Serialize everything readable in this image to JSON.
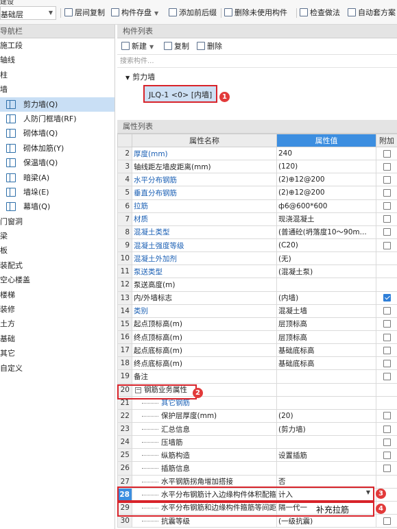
{
  "toolbar": {
    "menu_fragment": "建设",
    "floor_value": "基础层",
    "buttons": [
      {
        "label": "层间复制"
      },
      {
        "label": "构件存盘",
        "dropdown": true
      },
      {
        "label": "添加前后缀"
      },
      {
        "label": "删除未使用构件"
      },
      {
        "label": "检查做法"
      },
      {
        "label": "自动套方案"
      }
    ]
  },
  "nav": {
    "header": "导航栏",
    "items": [
      {
        "label": "施工段",
        "level": 0
      },
      {
        "label": "轴线",
        "level": 0
      },
      {
        "label": "柱",
        "level": 0
      },
      {
        "label": "墙",
        "level": 0
      },
      {
        "label": "剪力墙(Q)",
        "level": 1,
        "selected": true,
        "icon": "shear-wall-icon"
      },
      {
        "label": "人防门框墙(RF)",
        "level": 1,
        "icon": "civil-defense-door-frame-wall-icon"
      },
      {
        "label": "砌体墙(Q)",
        "level": 1,
        "icon": "masonry-wall-icon"
      },
      {
        "label": "砌体加筋(Y)",
        "level": 1,
        "icon": "masonry-reinforcement-icon"
      },
      {
        "label": "保温墙(Q)",
        "level": 1,
        "icon": "insulation-wall-icon"
      },
      {
        "label": "暗梁(A)",
        "level": 1,
        "icon": "hidden-beam-icon"
      },
      {
        "label": "墙垛(E)",
        "level": 1,
        "icon": "wall-pier-icon"
      },
      {
        "label": "幕墙(Q)",
        "level": 1,
        "icon": "curtain-wall-icon"
      },
      {
        "label": "门窗洞",
        "level": 0
      },
      {
        "label": "梁",
        "level": 0
      },
      {
        "label": "板",
        "level": 0
      },
      {
        "label": "装配式",
        "level": 0
      },
      {
        "label": "空心楼盖",
        "level": 0
      },
      {
        "label": "楼梯",
        "level": 0
      },
      {
        "label": "装修",
        "level": 0
      },
      {
        "label": "土方",
        "level": 0
      },
      {
        "label": "基础",
        "level": 0
      },
      {
        "label": "其它",
        "level": 0
      },
      {
        "label": "自定义",
        "level": 0
      }
    ]
  },
  "components": {
    "header": "构件列表",
    "new_label": "新建",
    "copy_label": "复制",
    "delete_label": "删除",
    "search_placeholder": "搜索构件...",
    "category": "剪力墙",
    "selected_item": "JLQ-1 <0> [内墙]",
    "badge": "1"
  },
  "properties": {
    "header": "属性列表",
    "columns": {
      "name": "属性名称",
      "value": "属性值",
      "extra": "附加"
    },
    "rows": [
      {
        "num": "2",
        "name": "厚度(mm)",
        "value": "240",
        "blue": true,
        "cb": "off"
      },
      {
        "num": "3",
        "name": "轴线距左墙皮距离(mm)",
        "value": "(120)",
        "blue": false,
        "cb": "off"
      },
      {
        "num": "4",
        "name": "水平分布钢筋",
        "value": "(2)⊕12@200",
        "blue": true,
        "cb": "off"
      },
      {
        "num": "5",
        "name": "垂直分布钢筋",
        "value": "(2)⊕12@200",
        "blue": true,
        "cb": "off"
      },
      {
        "num": "6",
        "name": "拉筋",
        "value": "ф6@600*600",
        "blue": true,
        "cb": "off"
      },
      {
        "num": "7",
        "name": "材质",
        "value": "现浇混凝土",
        "blue": true,
        "cb": "off"
      },
      {
        "num": "8",
        "name": "混凝土类型",
        "value": "(普通砼(坍落度10～90m...",
        "blue": true,
        "cb": "off"
      },
      {
        "num": "9",
        "name": "混凝土强度等级",
        "value": "(C20)",
        "blue": true,
        "cb": "off"
      },
      {
        "num": "10",
        "name": "混凝土外加剂",
        "value": "(无)",
        "blue": true,
        "cb": "none"
      },
      {
        "num": "11",
        "name": "泵送类型",
        "value": "(混凝土泵)",
        "blue": true,
        "cb": "none"
      },
      {
        "num": "12",
        "name": "泵送高度(m)",
        "value": "",
        "blue": false,
        "cb": "none"
      },
      {
        "num": "13",
        "name": "内/外墙标志",
        "value": "(内墙)",
        "blue": false,
        "cb": "on"
      },
      {
        "num": "14",
        "name": "类别",
        "value": "混凝土墙",
        "blue": true,
        "cb": "off"
      },
      {
        "num": "15",
        "name": "起点顶标高(m)",
        "value": "层顶标高",
        "blue": false,
        "cb": "off"
      },
      {
        "num": "16",
        "name": "终点顶标高(m)",
        "value": "层顶标高",
        "blue": false,
        "cb": "off"
      },
      {
        "num": "17",
        "name": "起点底标高(m)",
        "value": "基础底标高",
        "blue": false,
        "cb": "off"
      },
      {
        "num": "18",
        "name": "终点底标高(m)",
        "value": "基础底标高",
        "blue": false,
        "cb": "off"
      },
      {
        "num": "19",
        "name": "备注",
        "value": "",
        "blue": false,
        "cb": "off"
      },
      {
        "num": "20",
        "name": "钢筋业务属性",
        "value": "",
        "blue": false,
        "cb": "none",
        "group": true
      },
      {
        "num": "21",
        "name": "其它钢筋",
        "value": "",
        "blue": true,
        "cb": "none",
        "child": true
      },
      {
        "num": "22",
        "name": "保护层厚度(mm)",
        "value": "(20)",
        "blue": false,
        "cb": "off",
        "child": true
      },
      {
        "num": "23",
        "name": "汇总信息",
        "value": "(剪力墙)",
        "blue": false,
        "cb": "off",
        "child": true
      },
      {
        "num": "24",
        "name": "压墙筋",
        "value": "",
        "blue": false,
        "cb": "off",
        "child": true
      },
      {
        "num": "25",
        "name": "纵筋构造",
        "value": "设置插筋",
        "blue": false,
        "cb": "off",
        "child": true
      },
      {
        "num": "26",
        "name": "插筋信息",
        "value": "",
        "blue": false,
        "cb": "off",
        "child": true
      },
      {
        "num": "27",
        "name": "水平钢筋拐角增加搭接",
        "value": "否",
        "blue": false,
        "cb": "none",
        "child": true
      },
      {
        "num": "28",
        "name": "水平分布钢筋计入边缘构件体积配箍率",
        "value": "计入",
        "blue": false,
        "cb": "none",
        "child": true,
        "highlight": true,
        "combo": true
      },
      {
        "num": "29",
        "name": "水平分布钢筋和边缘构件箍筋等间距时",
        "value": "隔一代一",
        "blue": false,
        "cb": "none",
        "child": true
      },
      {
        "num": "30",
        "name": "抗震等级",
        "value": "(一级抗震)",
        "blue": false,
        "cb": "off",
        "child": true
      }
    ],
    "extra_note": "补充拉筋",
    "badges": [
      "2",
      "3",
      "4"
    ]
  },
  "colors": {
    "accent": "#3c8ee0",
    "selection": "#c9dff5",
    "annotation_red": "#d8232a",
    "link_blue": "#1a5fb4"
  }
}
